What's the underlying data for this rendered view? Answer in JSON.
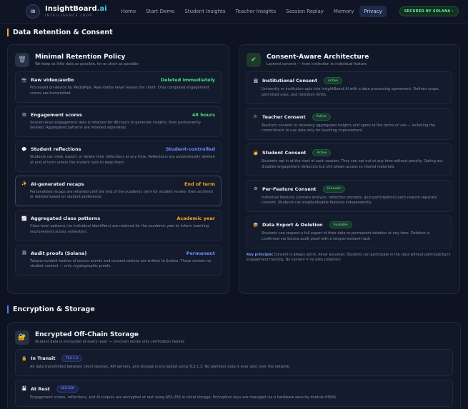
{
  "nav": {
    "logo_initials": "IB",
    "brand_main": "InsightBoard",
    "brand_accent": ".ai",
    "tagline": "INTELLIGENCE LOOP",
    "links": [
      "Home",
      "Start Demo",
      "Student Insights",
      "Teacher Insights",
      "Session Replay",
      "Memory",
      "Privacy"
    ],
    "active_link": "Privacy",
    "secured_label": "SECURED BY SOLANA",
    "secured_icon": "arrow-right-icon"
  },
  "retention_section": {
    "title": "Data Retention & Consent",
    "minimal": {
      "icon": "trash-icon",
      "title": "Minimal Retention Policy",
      "subtitle": "We keep as little data as possible, for as short as possible",
      "items": [
        {
          "icon": "camera-icon",
          "title": "Raw video/audio",
          "value": "Deleted immediately",
          "desc": "Processed on-device by MediaPipe. Raw media never leaves the client. Only computed engagement scores are transmitted."
        },
        {
          "icon": "bar-chart-icon",
          "title": "Engagement scores",
          "value": "48 hours",
          "desc": "Session-level engagement data is retained for 48 hours to generate insights, then permanently deleted. Aggregated patterns are retained separately."
        },
        {
          "icon": "speech-bubble-icon",
          "title": "Student reflections",
          "value": "Student-controlled",
          "desc": "Students can view, export, or delete their reflections at any time. Reflections are automatically deleted at end of term unless the student opts to keep them."
        },
        {
          "icon": "sparkle-icon",
          "title": "AI-generated recaps",
          "value": "End of term",
          "desc": "Personalized recaps are retained until the end of the academic term for student review, then archived or deleted based on student preference."
        },
        {
          "icon": "line-chart-icon",
          "title": "Aggregated class patterns",
          "value": "Academic year",
          "desc": "Class-level patterns (no individual identifiers) are retained for the academic year to inform teaching improvement across semesters."
        },
        {
          "icon": "chain-link-icon",
          "title": "Audit proofs (Solana)",
          "value": "Permanent",
          "desc": "Tamper-evident hashes of access events and consent actions are written to Solana. These contain no student content — only cryptographic proofs."
        }
      ]
    },
    "consent": {
      "icon": "checkmark-icon",
      "title": "Consent-Aware Architecture",
      "subtitle": "Layered consent — from institution to individual feature",
      "items": [
        {
          "icon": "institution-icon",
          "title": "Institutional Consent",
          "badge": "Active",
          "desc": "University or institution opts into InsightBoard AI with a data processing agreement. Defines scope, permitted uses, and retention limits."
        },
        {
          "icon": "graduation-cap-icon",
          "title": "Teacher Consent",
          "badge": "Active",
          "desc": "Teachers consent to receiving aggregated insights and agree to the terms of use — including the commitment to use data only for teaching improvement."
        },
        {
          "icon": "student-icon",
          "title": "Student Consent",
          "badge": "Active",
          "desc": "Students opt in at the start of each session. They can opt out at any time without penalty. Opting out disables engagement detection but still allows access to shared materials."
        },
        {
          "icon": "gear-icon",
          "title": "Per-Feature Consent",
          "badge": "Granular",
          "desc": "Individual features (camera analysis, reflection prompts, quiz participation) each require separate consent. Students can enable/disable features independently."
        },
        {
          "icon": "package-icon",
          "title": "Data Export & Deletion",
          "badge": "Available",
          "desc": "Students can request a full export of their data or permanent deletion at any time. Deletion is confirmed via Solana audit proof with a tamper-evident hash."
        }
      ],
      "key_principle_label": "Key principle:",
      "key_principle_text": " Consent is always opt-in, never assumed. Students can participate in the class without participating in engagement tracking. No consent = no data collection."
    }
  },
  "encryption_section": {
    "title": "Encryption & Storage",
    "storage": {
      "icon": "lock-icon",
      "title": "Encrypted Off-Chain Storage",
      "subtitle": "Student data is encrypted at every layer — on-chain stores only verification hashes",
      "items": [
        {
          "icon": "lock-icon",
          "title": "In Transit",
          "badge": "TLS 1.3",
          "desc": "All data transmitted between client devices, API servers, and storage is encrypted using TLS 1.3. No plaintext data is ever sent over the network."
        },
        {
          "icon": "floppy-disk-icon",
          "title": "At Rest",
          "badge": "AES-256",
          "desc": "Engagement scores, reflections, and AI outputs are encrypted at rest using AES-256 in cloud storage. Encryption keys are managed via a hardware security module (HSM)."
        }
      ]
    }
  }
}
